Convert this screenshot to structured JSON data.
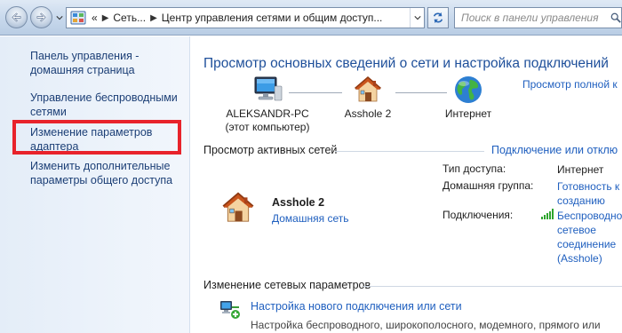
{
  "toolbar": {
    "breadcrumb_overflow": "«",
    "breadcrumbs": [
      "Сеть...",
      "Центр управления сетями и общим доступ..."
    ],
    "search_placeholder": "Поиск в панели управления"
  },
  "sidebar": {
    "items": [
      {
        "label": "Панель управления - домашняя страница"
      },
      {
        "label": "Управление беспроводными сетями"
      },
      {
        "label": "Изменение параметров адаптера",
        "highlighted": true
      },
      {
        "label": "Изменить дополнительные параметры общего доступа"
      }
    ],
    "highlight_color": "#e8232b"
  },
  "main": {
    "title": "Просмотр основных сведений о сети и настройка подключений",
    "full_map_link": "Просмотр полной к",
    "map_nodes": [
      {
        "label": "ALEKSANDR-PC",
        "sublabel": "(этот компьютер)",
        "icon": "computer-icon"
      },
      {
        "label": "Asshole  2",
        "icon": "house-icon"
      },
      {
        "label": "Интернет",
        "icon": "globe-icon"
      }
    ],
    "active_networks": {
      "heading": "Просмотр активных сетей",
      "connect_link": "Подключение или отклю",
      "network_name": "Asshole  2",
      "network_type": "Домашняя сеть",
      "access_type_label": "Тип доступа:",
      "access_type_value": "Интернет",
      "homegroup_label": "Домашняя группа:",
      "homegroup_value": [
        "Готовность к",
        "созданию"
      ],
      "connections_label": "Подключения:",
      "connections_value": [
        "Беспроводно",
        "сетевое",
        "соединение",
        "(Asshole)"
      ]
    },
    "change_settings": {
      "heading": "Изменение сетевых параметров",
      "new_connection_link": "Настройка нового подключения или сети",
      "new_connection_desc": "Настройка беспроводного, широкополосного, модемного, прямого или"
    }
  },
  "colors": {
    "link": "#1f5fbf",
    "title": "#1e4f9a",
    "sidebar_link": "#1c3f76"
  }
}
